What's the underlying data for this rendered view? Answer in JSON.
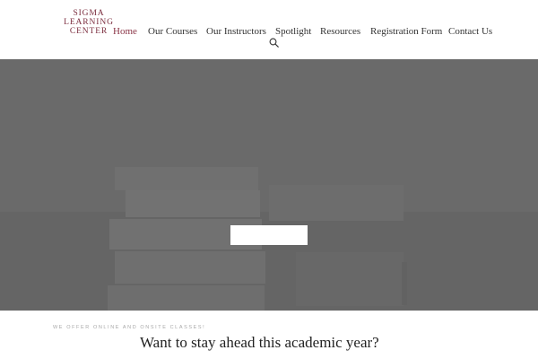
{
  "brand": {
    "line1": "SIGMA LEARNING",
    "line2": "CENTER",
    "color": "#7b2d3e"
  },
  "nav": {
    "items": [
      {
        "label": "Home",
        "active": true
      },
      {
        "label": "Our Courses",
        "active": false
      },
      {
        "label": "Our Instructors",
        "active": false
      },
      {
        "label": "Spotlight",
        "active": false
      },
      {
        "label": "Resources",
        "active": false
      },
      {
        "label": "Registration Form",
        "active": false
      },
      {
        "label": "Contact Us",
        "active": false
      }
    ],
    "active_color": "#8a3446",
    "search_icon": "search-icon"
  },
  "hero": {
    "overlay_color": "#6a6a6a",
    "button_label": "",
    "image": "stacked-books-photo"
  },
  "intro": {
    "kicker": "WE OFFER ONLINE AND ONSITE CLASSES!",
    "headline": "Want to stay ahead this academic year?"
  }
}
